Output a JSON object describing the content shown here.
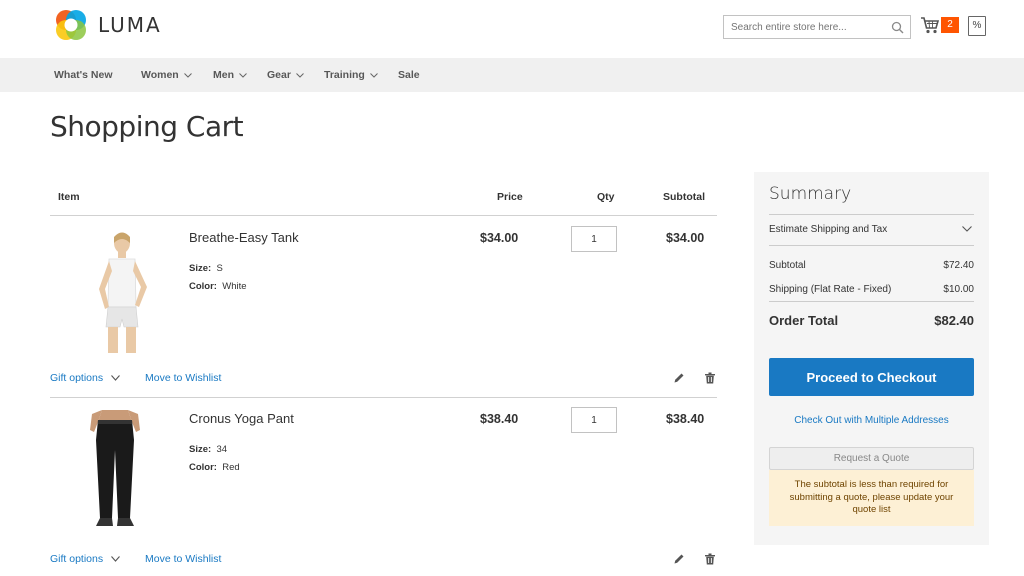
{
  "brand": {
    "name": "LUMA"
  },
  "search": {
    "placeholder": "Search entire store here..."
  },
  "minicart": {
    "count": "2"
  },
  "compare": {
    "glyph": "%"
  },
  "nav": {
    "items": [
      {
        "label": "What's New",
        "has_dropdown": false
      },
      {
        "label": "Women",
        "has_dropdown": true
      },
      {
        "label": "Men",
        "has_dropdown": true
      },
      {
        "label": "Gear",
        "has_dropdown": true
      },
      {
        "label": "Training",
        "has_dropdown": true
      },
      {
        "label": "Sale",
        "has_dropdown": false
      }
    ]
  },
  "page": {
    "title": "Shopping Cart"
  },
  "cart": {
    "headers": {
      "item": "Item",
      "price": "Price",
      "qty": "Qty",
      "subtotal": "Subtotal"
    },
    "items": [
      {
        "name": "Breathe-Easy Tank",
        "size_label": "Size:",
        "size": "S",
        "color_label": "Color:",
        "color": "White",
        "price": "$34.00",
        "qty": "1",
        "subtotal": "$34.00",
        "gift_options": "Gift options",
        "move_to_wishlist": "Move to Wishlist"
      },
      {
        "name": "Cronus Yoga Pant",
        "size_label": "Size:",
        "size": "34",
        "color_label": "Color:",
        "color": "Red",
        "price": "$38.40",
        "qty": "1",
        "subtotal": "$38.40",
        "gift_options": "Gift options",
        "move_to_wishlist": "Move to Wishlist"
      }
    ]
  },
  "summary": {
    "title": "Summary",
    "estimate": "Estimate Shipping and Tax",
    "subtotal_label": "Subtotal",
    "subtotal": "$72.40",
    "shipping_label": "Shipping (Flat Rate - Fixed)",
    "shipping": "$10.00",
    "order_total_label": "Order Total",
    "order_total": "$82.40",
    "checkout_button": "Proceed to Checkout",
    "multi_address_link": "Check Out with Multiple Addresses",
    "quote_button": "Request a Quote",
    "quote_message": "The subtotal is less than required for submitting a quote, please update your quote list"
  },
  "colors": {
    "accent": "#1979c3",
    "badge": "#ff5501",
    "nav_bg": "#f0f0f0",
    "summary_bg": "#f5f5f5",
    "notice_bg": "#fdf0d5"
  }
}
